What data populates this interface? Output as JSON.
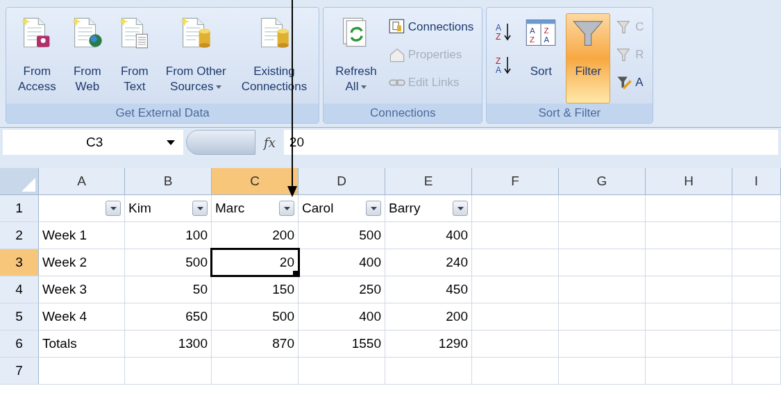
{
  "ribbon": {
    "groups": [
      {
        "label": "Get External Data",
        "buttons": [
          {
            "kind": "large",
            "label": "From Access",
            "menu": false
          },
          {
            "kind": "large",
            "label": "From Web",
            "menu": false
          },
          {
            "kind": "large",
            "label": "From Text",
            "menu": false
          },
          {
            "kind": "large",
            "label": "From Other Sources",
            "menu": true
          },
          {
            "kind": "large",
            "label": "Existing Connections",
            "menu": false
          }
        ]
      },
      {
        "label": "Connections",
        "buttons": [
          {
            "kind": "large",
            "label": "Refresh All",
            "menu": true
          },
          {
            "kind": "small",
            "label": "Connections",
            "disabled": false
          },
          {
            "kind": "small",
            "label": "Properties",
            "disabled": true
          },
          {
            "kind": "small",
            "label": "Edit Links",
            "disabled": true
          }
        ]
      },
      {
        "label": "Sort & Filter",
        "buttons": [
          {
            "kind": "sortpair",
            "glyphs": [
              [
                "A",
                "Z"
              ],
              [
                "Z",
                "A"
              ]
            ]
          },
          {
            "kind": "sortgrid",
            "label": "Sort",
            "glyphs": [
              "A",
              "Z",
              "Z",
              "A"
            ]
          },
          {
            "kind": "large",
            "label": "Filter",
            "menu": false,
            "selected": true
          },
          {
            "kind": "small",
            "label": "C",
            "disabled": true
          },
          {
            "kind": "small",
            "label": "R",
            "disabled": true
          },
          {
            "kind": "small",
            "label": "A",
            "disabled": false
          }
        ]
      }
    ]
  },
  "formula_bar": {
    "name_box": "C3",
    "function_label": "fx",
    "formula": "20"
  },
  "sheet": {
    "columns": [
      {
        "label": "A",
        "selected": false
      },
      {
        "label": "B",
        "selected": false
      },
      {
        "label": "C",
        "selected": true
      },
      {
        "label": "D",
        "selected": false
      },
      {
        "label": "E",
        "selected": false
      },
      {
        "label": "F",
        "selected": false
      },
      {
        "label": "G",
        "selected": false
      },
      {
        "label": "H",
        "selected": false
      },
      {
        "label": "I",
        "selected": false
      }
    ],
    "rows": [
      {
        "number": "1",
        "selected": false,
        "cells": [
          {
            "kind": "filter"
          },
          {
            "kind": "filter",
            "value": "Kim"
          },
          {
            "kind": "filter",
            "value": "Marc"
          },
          {
            "kind": "filter",
            "value": "Carol"
          },
          {
            "kind": "filter",
            "value": "Barry"
          }
        ]
      },
      {
        "number": "2",
        "selected": false,
        "cells": [
          {
            "kind": "text",
            "value": "Week 1"
          },
          {
            "kind": "number",
            "value": "100"
          },
          {
            "kind": "number",
            "value": "200"
          },
          {
            "kind": "number",
            "value": "500"
          },
          {
            "kind": "number",
            "value": "400"
          }
        ]
      },
      {
        "number": "3",
        "selected": true,
        "cells": [
          {
            "kind": "text",
            "value": "Week 2"
          },
          {
            "kind": "number",
            "value": "500"
          },
          {
            "kind": "number",
            "value": "20",
            "active": true
          },
          {
            "kind": "number",
            "value": "400"
          },
          {
            "kind": "number",
            "value": "240"
          }
        ]
      },
      {
        "number": "4",
        "selected": false,
        "cells": [
          {
            "kind": "text",
            "value": "Week 3"
          },
          {
            "kind": "number",
            "value": "50"
          },
          {
            "kind": "number",
            "value": "150"
          },
          {
            "kind": "number",
            "value": "250"
          },
          {
            "kind": "number",
            "value": "450"
          }
        ]
      },
      {
        "number": "5",
        "selected": false,
        "cells": [
          {
            "kind": "text",
            "value": "Week 4"
          },
          {
            "kind": "number",
            "value": "650"
          },
          {
            "kind": "number",
            "value": "500"
          },
          {
            "kind": "number",
            "value": "400"
          },
          {
            "kind": "number",
            "value": "200"
          }
        ]
      },
      {
        "number": "6",
        "selected": false,
        "cells": [
          {
            "kind": "text",
            "value": "Totals"
          },
          {
            "kind": "number",
            "value": "1300"
          },
          {
            "kind": "number",
            "value": "870"
          },
          {
            "kind": "number",
            "value": "1550"
          },
          {
            "kind": "number",
            "value": "1290"
          }
        ]
      },
      {
        "number": "7",
        "selected": false,
        "cells": []
      }
    ]
  }
}
